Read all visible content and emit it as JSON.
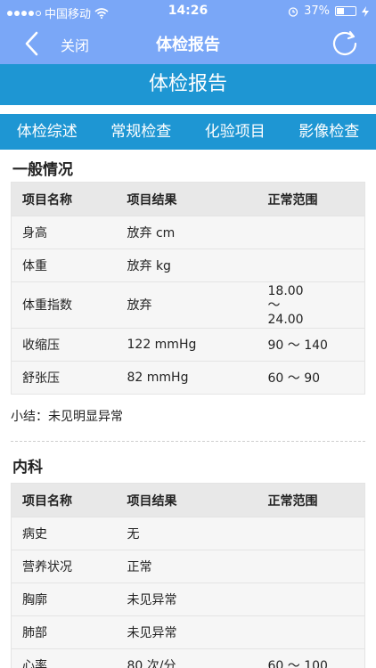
{
  "status": {
    "carrier": "中国移动",
    "time": "14:26",
    "battery": "37%",
    "battery_level": 0.37
  },
  "nav": {
    "close_label": "关闭",
    "title": "体检报告"
  },
  "banner": {
    "title": "体检报告"
  },
  "tabs": [
    {
      "label": "体检综述"
    },
    {
      "label": "常规检查"
    },
    {
      "label": "化验项目"
    },
    {
      "label": "影像检查"
    }
  ],
  "sections": [
    {
      "title": "一般情况",
      "headers": [
        "项目名称",
        "项目结果",
        "正常范围"
      ],
      "rows": [
        [
          "身高",
          "放弃 cm",
          ""
        ],
        [
          "体重",
          "放弃 kg",
          ""
        ],
        [
          "体重指数",
          "放弃",
          "18.00 ～ 24.00"
        ],
        [
          "收缩压",
          "122 mmHg",
          "90 ～ 140"
        ],
        [
          "舒张压",
          "82 mmHg",
          "60 ～ 90"
        ]
      ],
      "summary": "小结：未见明显异常"
    },
    {
      "title": "内科",
      "headers": [
        "项目名称",
        "项目结果",
        "正常范围"
      ],
      "rows": [
        [
          "病史",
          "无",
          ""
        ],
        [
          "营养状况",
          "正常",
          ""
        ],
        [
          "胸廓",
          "未见异常",
          ""
        ],
        [
          "肺部",
          "未见异常",
          ""
        ],
        [
          "心率",
          "80 次/分",
          "60 ～ 100"
        ]
      ]
    }
  ]
}
